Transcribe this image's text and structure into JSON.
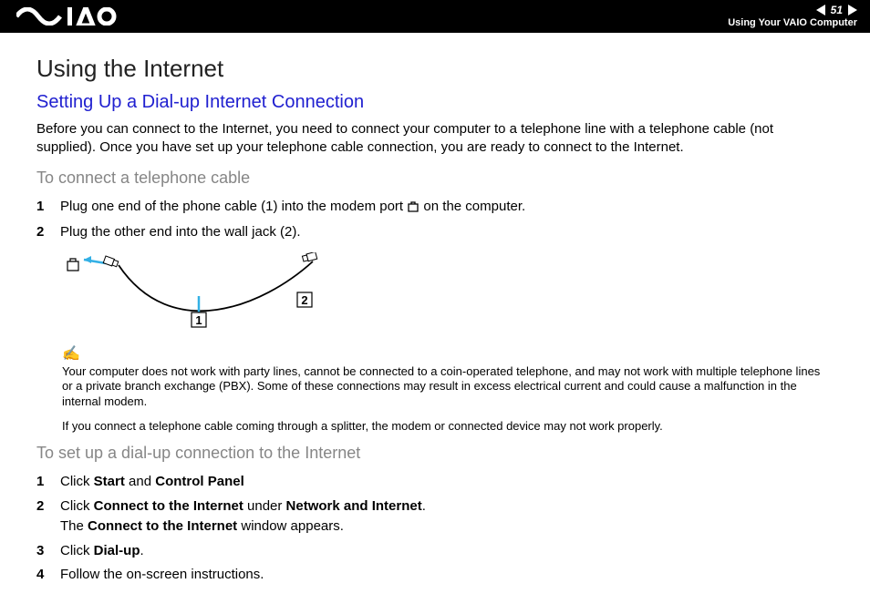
{
  "header": {
    "page_number": "51",
    "section": "Using Your VAIO Computer"
  },
  "title": "Using the Internet",
  "subtitle": "Setting Up a Dial-up Internet Connection",
  "intro": "Before you can connect to the Internet, you need to connect your computer to a telephone line with a telephone cable (not supplied). Once you have set up your telephone cable connection, you are ready to connect to the Internet.",
  "section_a": {
    "heading": "To connect a telephone cable",
    "steps": [
      {
        "num": "1",
        "pre": "Plug one end of the phone cable (1) into the modem port ",
        "post": " on the computer."
      },
      {
        "num": "2",
        "text": "Plug the other end into the wall jack (2)."
      }
    ],
    "diagram": {
      "label1": "1",
      "label2": "2"
    }
  },
  "note": {
    "p1": "Your computer does not work with party lines, cannot be connected to a coin-operated telephone, and may not work with multiple telephone lines or a private branch exchange (PBX). Some of these connections may result in excess electrical current and could cause a malfunction in the internal modem.",
    "p2": "If you connect a telephone cable coming through a splitter, the modem or connected device may not work properly."
  },
  "section_b": {
    "heading": "To set up a dial-up connection to the Internet",
    "steps": [
      {
        "num": "1",
        "pre": "Click ",
        "b1": "Start",
        "mid1": " and ",
        "b2": "Control Panel"
      },
      {
        "num": "2",
        "pre": "Click ",
        "b1": "Connect to the Internet",
        "mid1": " under ",
        "b2": "Network and Internet",
        "post1": ".",
        "line2_pre": "The ",
        "line2_b": "Connect to the Internet",
        "line2_post": " window appears."
      },
      {
        "num": "3",
        "pre": "Click ",
        "b1": "Dial-up",
        "post1": "."
      },
      {
        "num": "4",
        "text": "Follow the on-screen instructions."
      }
    ]
  }
}
